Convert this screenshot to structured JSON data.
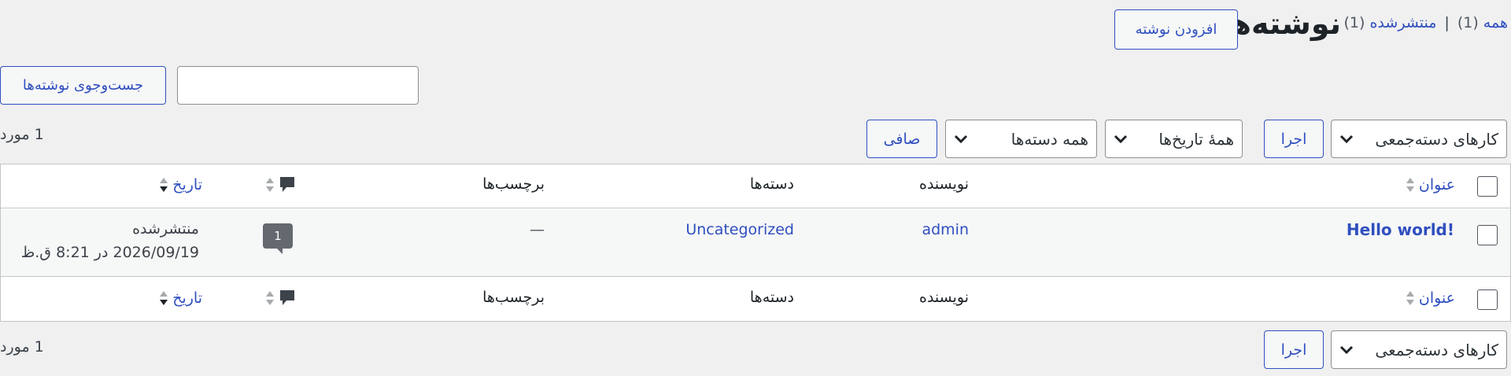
{
  "views": {
    "all_label": "همه",
    "all_count": "(1)",
    "separator": "|",
    "published_label": "منتشرشده",
    "published_count": "(1)"
  },
  "header": {
    "title": "نوشته‌ها",
    "add_new": "افزودن نوشته"
  },
  "search": {
    "value": "",
    "button": "جست‌وجوی نوشته‌ها"
  },
  "tablenav_top": {
    "bulk_actions": "کارهای دسته‌جمعی",
    "apply": "اجرا",
    "dates_filter": "همهٔ تاریخ‌ها",
    "categories_filter": "همه دسته‌ها",
    "filter_button": "صافی",
    "items_count": "1 مورد"
  },
  "table": {
    "columns": {
      "title": "عنوان",
      "author": "نویسنده",
      "categories": "دسته‌ها",
      "tags": "برچسب‌ها",
      "date": "تاریخ"
    },
    "rows": [
      {
        "title": "Hello world!",
        "author": "admin",
        "categories": "Uncategorized",
        "tags": "—",
        "comments": "1",
        "status": "منتشرشده",
        "date": "2026/09/19 در 8:21 ق.ظ"
      }
    ]
  },
  "tablenav_bottom": {
    "bulk_actions": "کارهای دسته‌جمعی",
    "apply": "اجرا",
    "items_count": "1 مورد"
  },
  "colors": {
    "accent": "#2f4fbf",
    "background": "#f0f0f1",
    "comment_badge": "#646970"
  },
  "icons": [
    "chevron-down-icon",
    "sort-arrows-icon",
    "comment-bubble-icon"
  ]
}
